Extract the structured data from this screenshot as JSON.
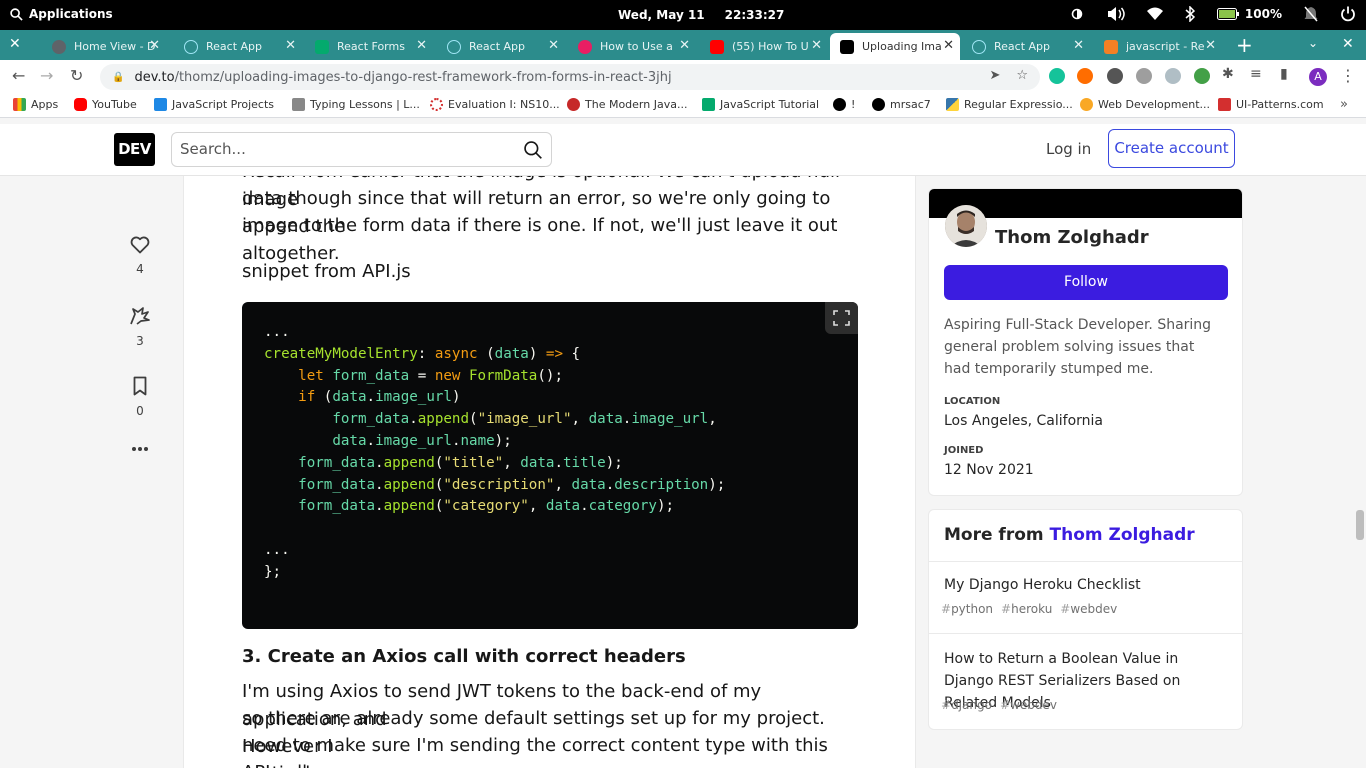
{
  "system": {
    "apps_label": "Applications",
    "date": "Wed, May 11",
    "time": "22:33:27",
    "battery": "100%"
  },
  "tabs": [
    {
      "label": "Home View - D",
      "color": "#5f6368"
    },
    {
      "label": "React App",
      "color": "#61dafb"
    },
    {
      "label": "React Forms",
      "color": "#04aa6d"
    },
    {
      "label": "React App",
      "color": "#61dafb"
    },
    {
      "label": "How to Use a",
      "color": "#e91e63"
    },
    {
      "label": "(55) How To U",
      "color": "#ff0000"
    },
    {
      "label": "Uploading Ima",
      "color": "#000000"
    },
    {
      "label": "React App",
      "color": "#61dafb"
    },
    {
      "label": "javascript - Re",
      "color": "#f48024"
    }
  ],
  "address": {
    "host": "dev.to",
    "path": "/thomz/uploading-images-to-django-rest-framework-from-forms-in-react-3jhj",
    "profile_initial": "A"
  },
  "bookmarks": [
    {
      "label": "Apps",
      "color": "#4285f4"
    },
    {
      "label": "YouTube",
      "color": "#ff0000"
    },
    {
      "label": "JavaScript Projects",
      "color": "#1e88e5"
    },
    {
      "label": "Typing Lessons | L...",
      "color": "#888888"
    },
    {
      "label": "Evaluation I: NS10...",
      "color": "#d32f2f"
    },
    {
      "label": "The Modern Java...",
      "color": "#c62828"
    },
    {
      "label": "JavaScript Tutorial",
      "color": "#04aa6d"
    },
    {
      "label": "!",
      "color": "#000000"
    },
    {
      "label": "mrsac7",
      "color": "#000000"
    },
    {
      "label": "Regular Expressio...",
      "color": "#3776ab"
    },
    {
      "label": "Web Development...",
      "color": "#f9a825"
    },
    {
      "label": "UI-Patterns.com",
      "color": "#d32f2f"
    }
  ],
  "header": {
    "logo": "DEV",
    "search_placeholder": "Search...",
    "login": "Log in",
    "create_account": "Create account"
  },
  "reactions": {
    "likes": "4",
    "unicorns": "3",
    "saves": "0"
  },
  "article": {
    "para1_line1": "Recall from earlier that the image is optional. We can't upload null image",
    "para1_line2": "data though since that will return an error, so we're only going to append the",
    "para1_line3": "image to the form data if there is one. If not, we'll just leave it out altogether.",
    "snippet_label": "snippet from API.js",
    "heading": "3. Create an Axios call with correct headers",
    "para2_line1": "I'm using Axios to send JWT tokens to the back-end of my application, and",
    "para2_line2": "so there are already some default settings set up for my project. However I",
    "para2_line3": "need to make sure I'm sending the correct content type with this particular",
    "para2_line4": "API call."
  },
  "code": {
    "l1": "...",
    "l2_fn": "createMyModelEntry",
    "l2_rest": ": ",
    "l2_async": "async",
    "l2_open": " (",
    "l2_arg": "data",
    "l2_close": ") ",
    "l2_arrow": "=>",
    "l2_brace": " {",
    "l3_let": "let",
    "l3_var": "form_data",
    "l3_eq": " = ",
    "l3_new": "new",
    "l3_cls": "FormData",
    "l3_end": "();",
    "l4_if": "if",
    "l4_obj": "data",
    "l4_prop": "image_url",
    "l5_obj": "form_data",
    "l5_fn": "append",
    "l5_str": "\"image_url\"",
    "l5_arg": "data",
    "l5_prop": "image_url",
    "l6_obj": "data",
    "l6_prop": "image_url",
    "l6_prop2": "name",
    "l7_str": "\"title\"",
    "l7_prop": "title",
    "l8_str": "\"description\"",
    "l8_prop": "description",
    "l9_str": "\"category\"",
    "l9_prop": "category",
    "l10": "...",
    "l11": "};"
  },
  "profile": {
    "name": "Thom Zolghadr",
    "follow": "Follow",
    "bio": "Aspiring Full-Stack Developer. Sharing general problem solving issues that had temporarily stumped me.",
    "location_label": "LOCATION",
    "location": "Los Angeles, California",
    "joined_label": "JOINED",
    "joined": "12 Nov 2021"
  },
  "more_from": {
    "prefix": "More from ",
    "author": "Thom Zolghadr",
    "items": [
      {
        "title": "My Django Heroku Checklist",
        "tags": [
          "python",
          "heroku",
          "webdev"
        ]
      },
      {
        "title": "How to Return a Boolean Value in Django REST Serializers Based on Related Models",
        "tags": [
          "django",
          "webdev"
        ]
      }
    ]
  },
  "colors": {
    "accent": "#3b49df",
    "follow": "#3b1ce0",
    "tabbar": "#2c8c8c"
  }
}
